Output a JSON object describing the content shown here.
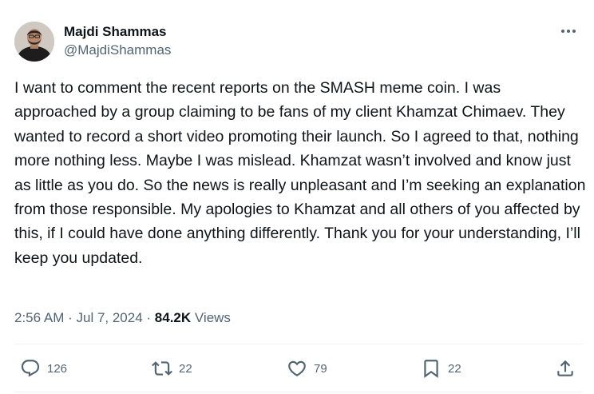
{
  "author": {
    "display_name": "Majdi Shammas",
    "handle": "@MajdiShammas"
  },
  "tweet": {
    "text": "I want to comment the recent reports on the SMASH meme coin. I was approached by a group claiming to be fans of my client Khamzat Chimaev. They wanted to record a short video promoting their launch. So I agreed to that, nothing more nothing less. Maybe I was mislead. Khamzat wasn’t involved and know just as little as you do. So the news is really unpleasant and I’m seeking an explanation from those responsible. My apologies to Khamzat and all others of you affected by this, if I could have done anything differently. Thank you for your understanding, I’ll keep you updated.",
    "time": "2:56 AM",
    "separator": " · ",
    "date": "Jul 7, 2024",
    "views_count": "84.2K",
    "views_label": "Views"
  },
  "actions": {
    "replies": "126",
    "reposts": "22",
    "likes": "79",
    "bookmarks": "22"
  },
  "icons": {
    "more": "more-horizontal-icon",
    "reply": "reply-bubble-icon",
    "repost": "repost-arrows-icon",
    "like": "heart-icon",
    "bookmark": "bookmark-icon",
    "share": "share-upload-icon"
  },
  "colors": {
    "text_primary": "#0f1419",
    "text_secondary": "#536471",
    "divider": "#eff3f4"
  }
}
